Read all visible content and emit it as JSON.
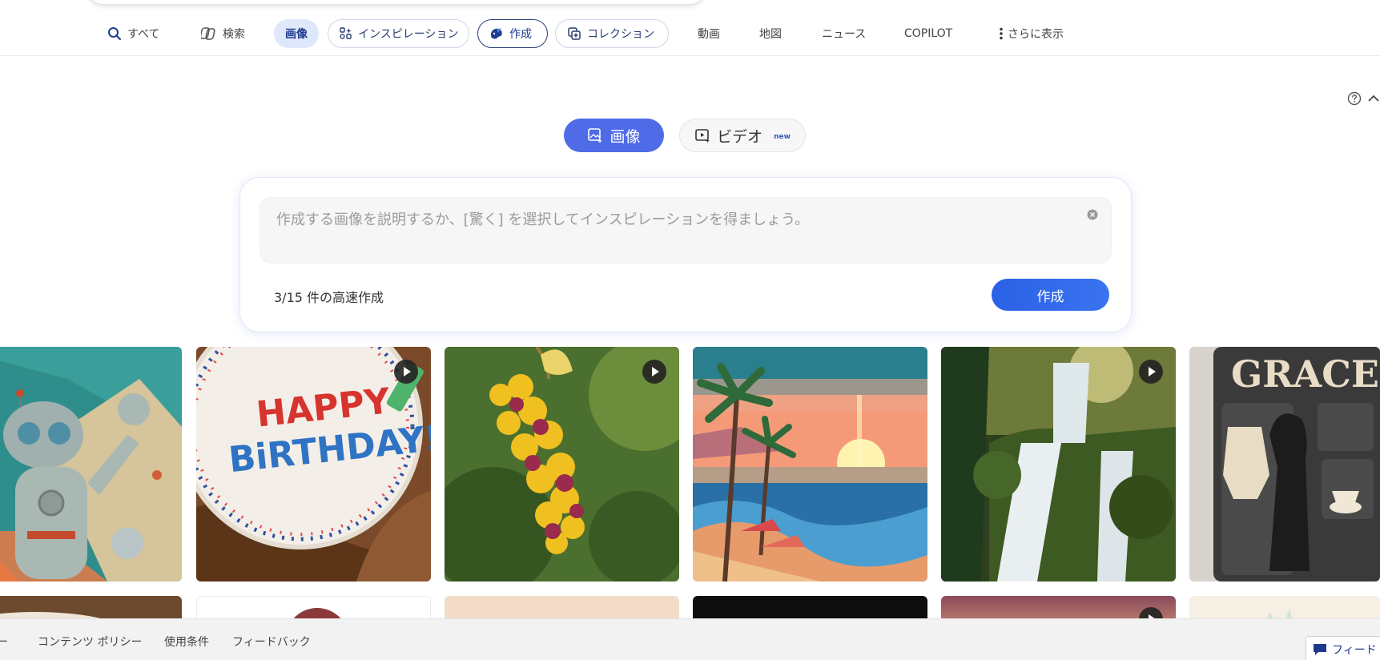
{
  "nav": {
    "items": [
      {
        "label": "すべて",
        "icon": "search-icon"
      },
      {
        "label": "検索",
        "icon": "copilot-icon"
      },
      {
        "label": "画像",
        "icon": ""
      },
      {
        "label": "インスピレーション",
        "icon": "sparkle-grid-icon"
      },
      {
        "label": "作成",
        "icon": "palette-icon"
      },
      {
        "label": "コレクション",
        "icon": "collection-icon"
      },
      {
        "label": "動画",
        "icon": ""
      },
      {
        "label": "地図",
        "icon": ""
      },
      {
        "label": "ニュース",
        "icon": ""
      },
      {
        "label": "COPILOT",
        "icon": ""
      },
      {
        "label": "さらに表示",
        "icon": "more-vertical-icon"
      }
    ]
  },
  "mode": {
    "image_label": "画像",
    "video_label": "ビデオ",
    "video_badge": "new"
  },
  "create": {
    "placeholder": "作成する画像を説明するか、[驚く] を選択してインスピレーションを得ましょう。",
    "value": "",
    "boost_text": "3/15 件の高速作成",
    "create_label": "作成"
  },
  "gallery": {
    "tiles": [
      {
        "name": "retro-robot",
        "video": false
      },
      {
        "name": "birthday-cake",
        "video": true,
        "text": [
          "HAPPY",
          "BiRTHDAY!"
        ]
      },
      {
        "name": "flower-cluster",
        "video": true
      },
      {
        "name": "pixel-beach-sunset",
        "video": false
      },
      {
        "name": "jungle-waterfall",
        "video": true
      },
      {
        "name": "dog-nameplate",
        "video": false,
        "text": [
          "GRACE"
        ]
      }
    ]
  },
  "footer": {
    "links": [
      "ー",
      "コンテンツ ポリシー",
      "使用条件",
      "フィードバック"
    ],
    "feedback_button": "フィード"
  },
  "colors": {
    "accent": "#4f6be8",
    "create_button": "#2b61e6",
    "selected_tab": "#dfe7fb"
  }
}
